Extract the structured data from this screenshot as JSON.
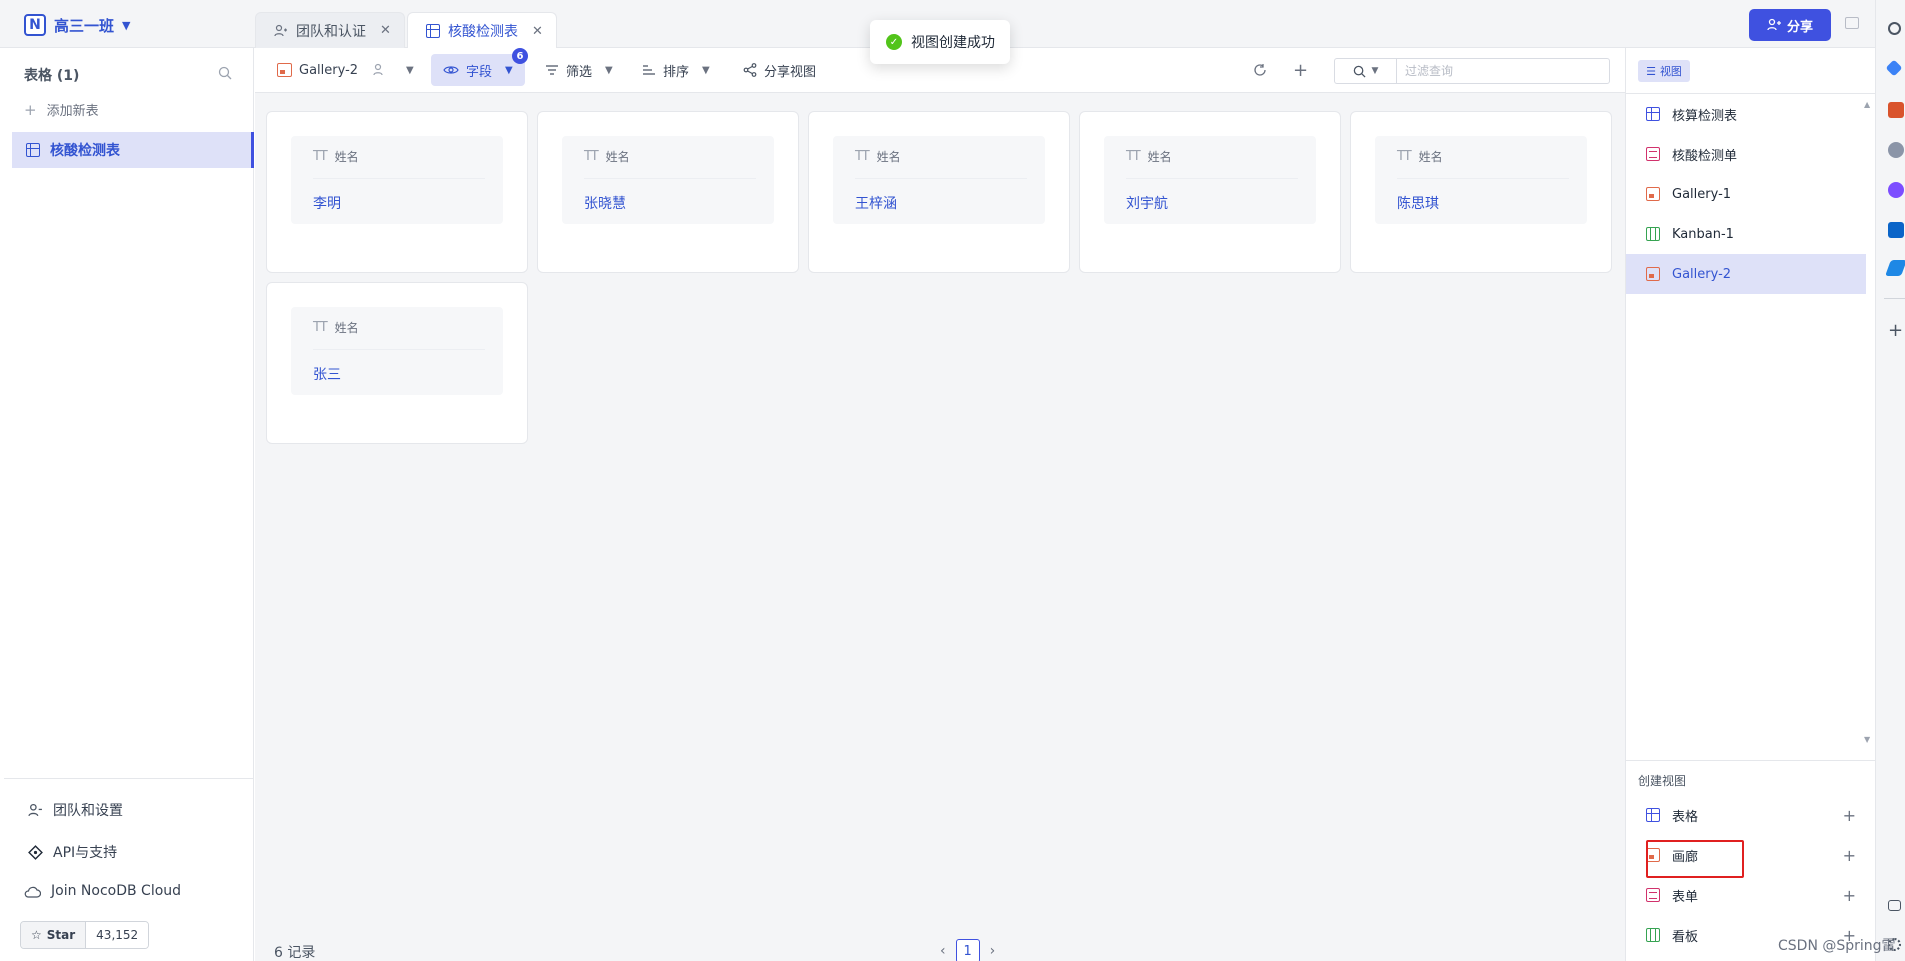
{
  "workspace": {
    "name": "高三一班"
  },
  "tabs": [
    {
      "label": "团队和认证",
      "active": false
    },
    {
      "label": "核酸检测表",
      "active": true
    }
  ],
  "toast": {
    "message": "视图创建成功"
  },
  "header": {
    "share_label": "分享"
  },
  "sidebar": {
    "title": "表格 (1)",
    "add_table": "添加新表",
    "items": [
      {
        "label": "核酸检测表",
        "active": true
      }
    ],
    "footer": [
      {
        "label": "团队和设置"
      },
      {
        "label": "API与支持"
      },
      {
        "label": "Join NocoDB Cloud"
      }
    ],
    "star": {
      "label": "Star",
      "count": "43,152"
    }
  },
  "toolbar": {
    "view_name": "Gallery-2",
    "fields_label": "字段",
    "fields_badge": "6",
    "filter_label": "筛选",
    "sort_label": "排序",
    "share_view_label": "分享视图",
    "search_placeholder": "过滤查询"
  },
  "gallery": {
    "field_label": "姓名",
    "field_type_glyph": "TT",
    "cards": [
      "李明",
      "张晓慧",
      "王梓涵",
      "刘宇航",
      "陈思琪",
      "张三"
    ]
  },
  "footer": {
    "records": "6 记录",
    "page": "1"
  },
  "views_panel": {
    "header": "视图",
    "views": [
      {
        "label": "核算检测表",
        "type": "grid",
        "active": false
      },
      {
        "label": "核酸检测单",
        "type": "form",
        "active": false
      },
      {
        "label": "Gallery-1",
        "type": "gallery",
        "active": false
      },
      {
        "label": "Kanban-1",
        "type": "kanban",
        "active": false
      },
      {
        "label": "Gallery-2",
        "type": "gallery",
        "active": true
      }
    ],
    "create_title": "创建视图",
    "create_items": [
      {
        "label": "表格",
        "type": "grid"
      },
      {
        "label": "画廊",
        "type": "gallery"
      },
      {
        "label": "表单",
        "type": "form"
      },
      {
        "label": "看板",
        "type": "kanban"
      }
    ]
  },
  "watermark": "CSDN @Spring雷",
  "colors": {
    "accent": "#3f51e0",
    "active_bg": "#dee1f8",
    "success": "#52c41a",
    "highlight": "#e02020"
  }
}
